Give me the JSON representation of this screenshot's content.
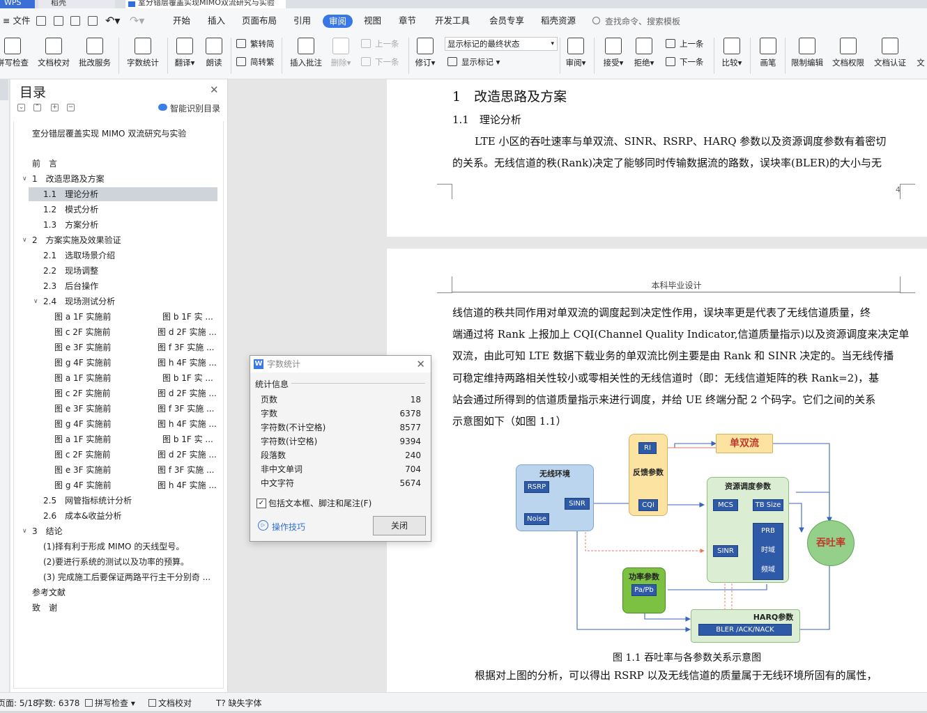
{
  "tabs": {
    "first": "WPS",
    "second": "稻壳",
    "document": "室分错层覆盖实现MIMO双流研究与实验"
  },
  "menu": {
    "file": "文件",
    "items": [
      "开始",
      "插入",
      "页面布局",
      "引用",
      "审阅",
      "视图",
      "章节",
      "开发工具",
      "会员专享",
      "稻壳资源"
    ],
    "active": "审阅",
    "search_placeholder": "查找命令、搜索模板"
  },
  "ribbon": {
    "spell_check": "拼写检查",
    "doc_proofread": "文档校对",
    "grading_service": "批改服务",
    "word_count": "字数统计",
    "translate": "翻译",
    "read_aloud": "朗读",
    "trad_to_simp": "繁转简",
    "simp_to_trad": "简转繁",
    "insert_comment": "插入批注",
    "delete": "删除",
    "prev_comment": "上一条",
    "next_comment": "下一条",
    "track_changes": "修订",
    "markup_mode": "显示标记的最终状态",
    "show_markup": "显示标记",
    "review_pane": "审阅",
    "accept": "接受",
    "reject": "拒绝",
    "prev_change": "上一条",
    "next_change": "下一条",
    "compare": "比较",
    "ink": "画笔",
    "restrict_editing": "限制编辑",
    "doc_permission": "文档权限",
    "doc_certify": "文档认证",
    "doc_more": "文"
  },
  "toc": {
    "title": "目录",
    "smart_detect": "智能识别目录",
    "doc_title": "室分错层覆盖实现 MIMO 双流研究与实验",
    "items": [
      "前　言",
      "1　改造思路及方案",
      "1.1　理论分析",
      "1.2　模式分析",
      "1.3　方案分析",
      "2　方案实施及效果验证",
      "2.1　选取场景介绍",
      "2.2　现场调整",
      "2.3　后台操作",
      "2.4　现场测试分析",
      "2.5　网管指标统计分析",
      "2.6　成本&收益分析",
      "3　结论",
      "(1)择有利于形成 MIMO 的天线型号。",
      "(2)要进行系统的测试以及功率的预算。",
      "(3) 完成施工后要保证两路平行主干分别奇 ...",
      "参考文献",
      "致　谢"
    ],
    "figure_rows": [
      [
        "图 a 1F 实施前",
        "图 b 1F 实 ..."
      ],
      [
        "图 c 2F 实施前",
        "图 d 2F 实施 ..."
      ],
      [
        "图 e 3F 实施前",
        "图 f 3F 实施 ..."
      ],
      [
        "图 g 4F 实施前",
        "图 h 4F 实施 ..."
      ],
      [
        "图 a 1F 实施前",
        "图 b 1F 实 ..."
      ],
      [
        "图 c 2F 实施前",
        "图 d 2F 实施 ..."
      ],
      [
        "图 e 3F 实施前",
        "图 f 3F 实施 ..."
      ],
      [
        "图 g 4F 实施前",
        "图 h 4F 实施 ..."
      ],
      [
        "图 a 1F 实施前",
        "图 b 1F 实 ..."
      ],
      [
        "图 c 2F 实施前",
        "图 d 2F 实施 ..."
      ],
      [
        "图 e 3F 实施前",
        "图 f 3F 实施 ..."
      ],
      [
        "图 g 4F 实施前",
        "图 h 4F 实施 ..."
      ]
    ]
  },
  "document": {
    "page1": {
      "h1": "1　改造思路及方案",
      "h2": "1.1　理论分析",
      "lines": [
        "LTE 小区的吞吐速率与单双流、SINR、RSRP、HARQ 参数以及资源调度参数有着密切",
        "的关系。无线信道的秩(Rank)决定了能够同时传输数据流的路数，误块率(BLER)的大小与无"
      ],
      "page_number": "4"
    },
    "page2": {
      "header": "本科毕业设计",
      "lines": [
        "线信道的秩共同作用对单双流的调度起到决定性作用，误块率更是代表了无线信道质量，终",
        "端通过将 Rank 上报加上 CQI(Channel Quality Indicator,信道质量指示)以及资源调度来决定单",
        "双流，由此可知 LTE 数据下载业务的单双流比例主要是由 Rank 和 SINR 决定的。当无线传播",
        "可稳定维持两路相关性较小或零相关性的无线信道时（即：无线信道矩阵的秩 Rank=2)，基",
        "站会通过所得到的信道质量指示来进行调度，并给 UE 终端分配  2 个码字。它们之间的关系",
        "示意图如下（如图 1.1）"
      ],
      "caption": "图 1.1  吞吐率与各参数关系示意图",
      "after": "根据对上图的分析，可以得出 RSRP 以及无线信道的质量属于无线环境所固有的属性，"
    },
    "figure": {
      "wireless": "无线环境",
      "rsrp": "RSRP",
      "noise": "Noise",
      "sinr": "SINR",
      "feedback": "反馈参数",
      "ri": "RI",
      "cqi": "CQI",
      "single_dual": "单双流",
      "resource": "资源调度参数",
      "mcs": "MCS",
      "tbsize": "TB Size",
      "prb": "PRB",
      "time": "时域",
      "freq": "频域",
      "sinr2": "SINR",
      "throughput": "吞吐率",
      "power": "功率参数",
      "papb": "Pa/Pb",
      "harq": "HARQ参数",
      "bler": "BLER /ACK/NACK"
    }
  },
  "dialog": {
    "title": "字数统计",
    "section": "统计信息",
    "stats": [
      {
        "label": "页数",
        "value": "18"
      },
      {
        "label": "字数",
        "value": "6378"
      },
      {
        "label": "字符数(不计空格)",
        "value": "8577"
      },
      {
        "label": "字符数(计空格)",
        "value": "9394"
      },
      {
        "label": "段落数",
        "value": "240"
      },
      {
        "label": "非中文单词",
        "value": "704"
      },
      {
        "label": "中文字符",
        "value": "5674"
      }
    ],
    "include_label": "包括文本框、脚注和尾注(F)",
    "tips": "操作技巧",
    "close": "关闭"
  },
  "status": {
    "page": "页面: 5/18",
    "words": "字数: 6378",
    "spell": "拼写检查",
    "proof": "文档校对",
    "missing_font": "缺失字体"
  }
}
